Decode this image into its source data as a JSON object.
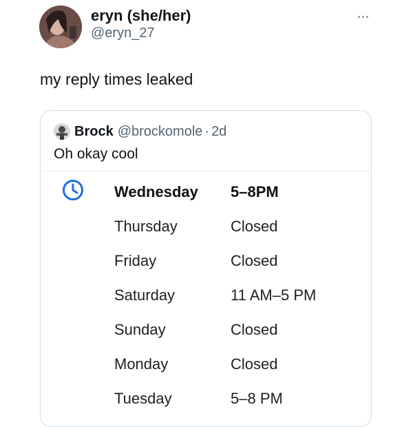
{
  "author": {
    "name": "eryn (she/her)",
    "handle": "@eryn_27"
  },
  "tweet": {
    "text": "my reply times leaked"
  },
  "quote": {
    "author_name": "Brock",
    "author_handle": "@brockomole",
    "separator": "·",
    "time": "2d",
    "text": "Oh okay cool"
  },
  "hours": [
    {
      "day": "Wednesday",
      "time": "5–8PM",
      "today": true
    },
    {
      "day": "Thursday",
      "time": "Closed",
      "today": false
    },
    {
      "day": "Friday",
      "time": "Closed",
      "today": false
    },
    {
      "day": "Saturday",
      "time": "11 AM–5 PM",
      "today": false
    },
    {
      "day": "Sunday",
      "time": "Closed",
      "today": false
    },
    {
      "day": "Monday",
      "time": "Closed",
      "today": false
    },
    {
      "day": "Tuesday",
      "time": "5–8 PM",
      "today": false
    }
  ],
  "icons": {
    "more": "more-horizontal-icon",
    "clock": "clock-icon"
  },
  "colors": {
    "accent_blue": "#1d6fe0",
    "secondary_text": "#536471"
  }
}
